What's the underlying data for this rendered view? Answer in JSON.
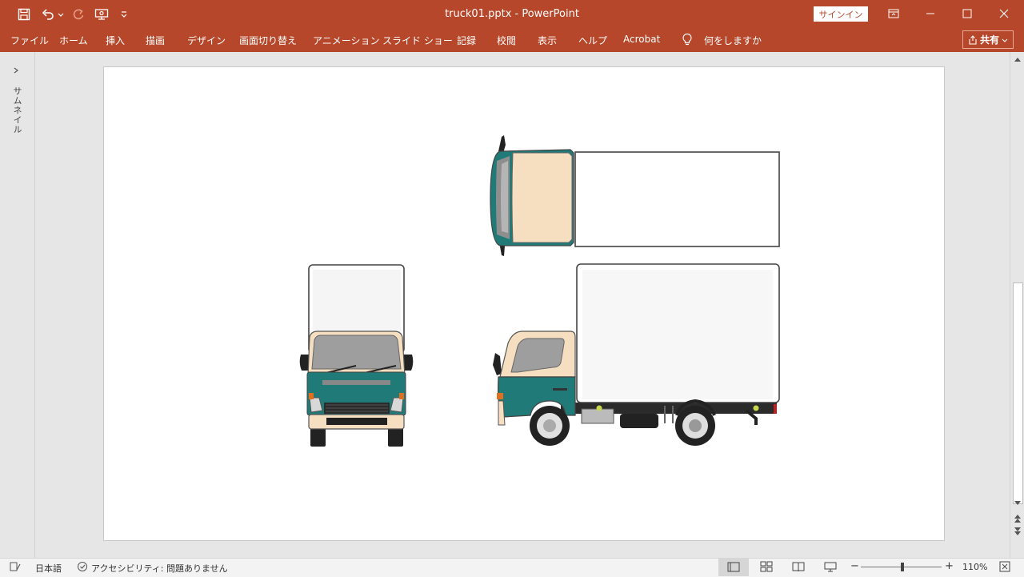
{
  "window": {
    "title": "truck01.pptx  -  PowerPoint",
    "signin_label": "サインイン"
  },
  "quick_access": {
    "icons": [
      "save-icon",
      "undo-icon",
      "redo-icon",
      "present-from-start-icon",
      "customize-qat-icon"
    ]
  },
  "menu": {
    "tabs": [
      "ファイル",
      "ホーム",
      "挿入",
      "描画",
      "デザイン",
      "画面切り替え",
      "アニメーション",
      "スライド ショー",
      "記録",
      "校閲",
      "表示",
      "ヘルプ",
      "Acrobat"
    ],
    "tell_me": "何をしますか",
    "share_label": "共有"
  },
  "thumbnail_pane": {
    "label": "サムネイル"
  },
  "status": {
    "language": "日本語",
    "accessibility": "アクセシビリティ: 問題ありません",
    "zoom": "110%"
  },
  "colors": {
    "accent": "#b7472a",
    "truck_teal": "#1f7a78",
    "truck_cream": "#f5dfc0"
  }
}
